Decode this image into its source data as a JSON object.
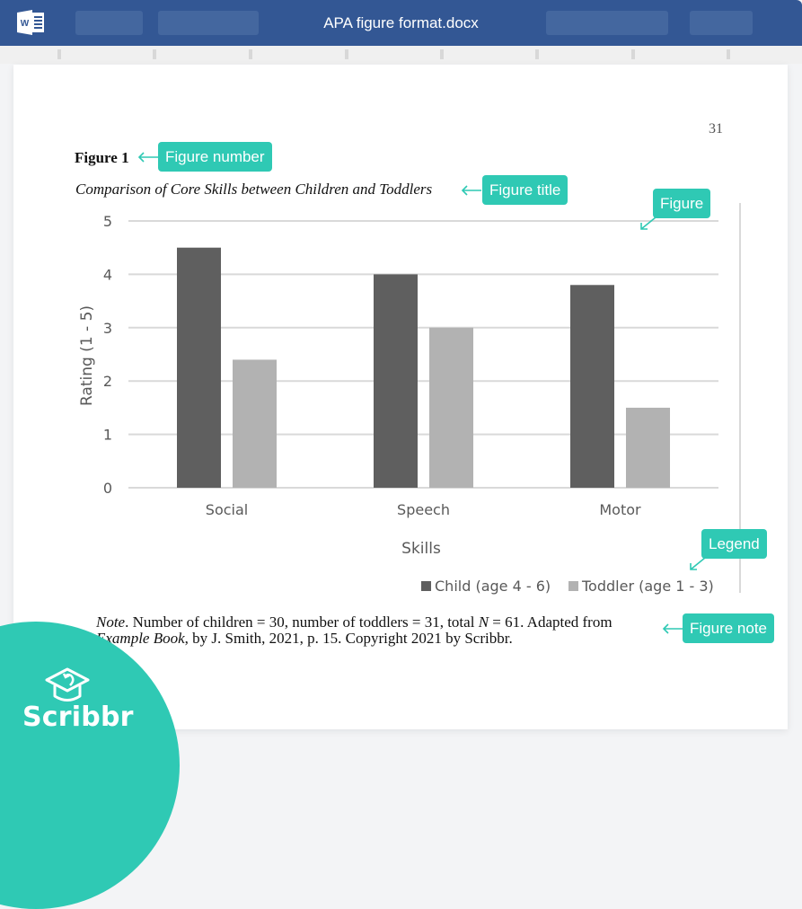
{
  "app": {
    "icon": "word-icon",
    "document_title": "APA figure format.docx",
    "brand_color": "#335794",
    "accent_color": "#2fc9b4"
  },
  "page": {
    "page_number": "31",
    "figure_number": "Figure 1",
    "figure_title": "Comparison of Core Skills between Children and Toddlers",
    "note": {
      "label": "Note",
      "text_1": ". Number of children = 30, number of toddlers = 31, total ",
      "n_symbol": "N",
      "text_2": " = 61. Adapted from ",
      "source_title": "Example Book",
      "text_3": ", by J. Smith, 2021, p. 15. Copyright 2021 by Scribbr."
    }
  },
  "callouts": {
    "figure_number": "Figure number",
    "figure_title": "Figure title",
    "figure": "Figure",
    "legend": "Legend",
    "figure_note": "Figure note"
  },
  "branding": {
    "logo_icon": "graduation-cap-icon",
    "name": "Scribbr"
  },
  "chart_data": {
    "type": "bar",
    "title": "Comparison of Core Skills between Children and Toddlers",
    "xlabel": "Skills",
    "ylabel": "Rating (1 - 5)",
    "categories": [
      "Social",
      "Speech",
      "Motor"
    ],
    "series": [
      {
        "name": "Child (age 4 - 6)",
        "color": "#5f5f5f",
        "values": [
          4.5,
          4.0,
          3.8
        ]
      },
      {
        "name": "Toddler (age 1 - 3)",
        "color": "#b2b2b2",
        "values": [
          2.4,
          3.0,
          1.5
        ]
      }
    ],
    "ylim": [
      0,
      5
    ],
    "yticks": [
      "0",
      "1",
      "2",
      "3",
      "4",
      "5"
    ],
    "grid": true,
    "legend_position": "bottom-right"
  }
}
